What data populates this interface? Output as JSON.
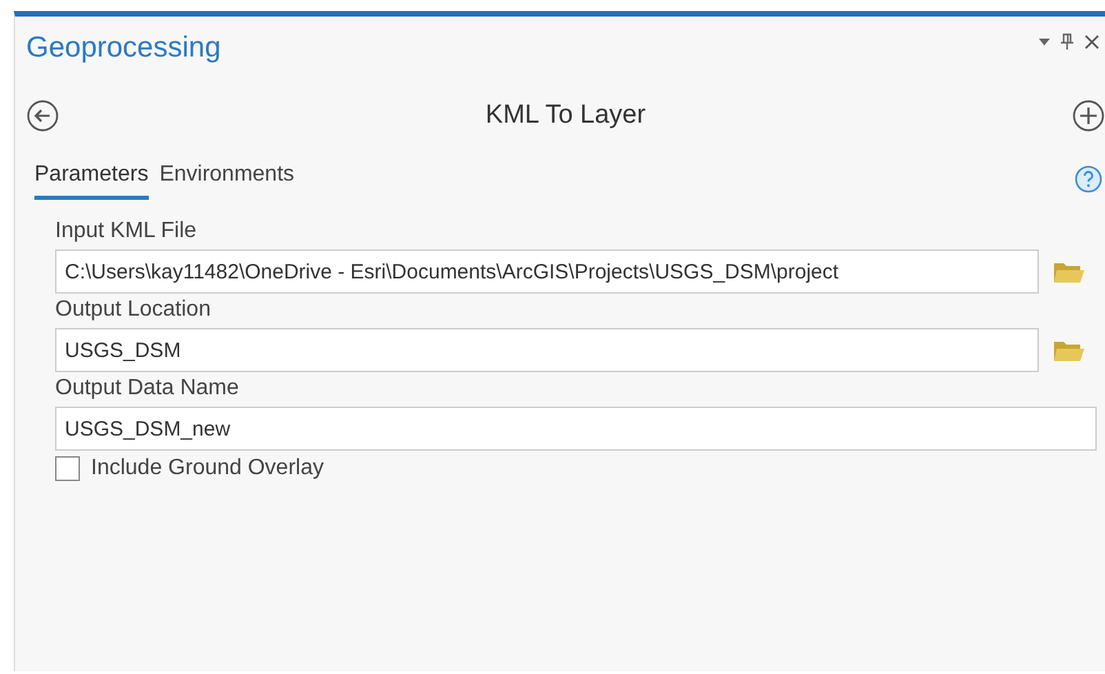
{
  "pane": {
    "title": "Geoprocessing"
  },
  "tool": {
    "title": "KML To Layer"
  },
  "tabs": [
    {
      "label": "Parameters",
      "selected": true
    },
    {
      "label": "Environments",
      "selected": false
    }
  ],
  "parameters": [
    {
      "label": "Input KML File",
      "value": "C:\\Users\\kay11482\\OneDrive - Esri\\Documents\\ArcGIS\\Projects\\USGS_DSM\\project",
      "kind": "browse"
    },
    {
      "label": "Output Location",
      "value": "USGS_DSM",
      "kind": "browse"
    },
    {
      "label": "Output Data Name",
      "value": "USGS_DSM_new",
      "kind": "text"
    }
  ],
  "options": [
    {
      "label": "Include Ground Overlay",
      "checked": false
    }
  ]
}
